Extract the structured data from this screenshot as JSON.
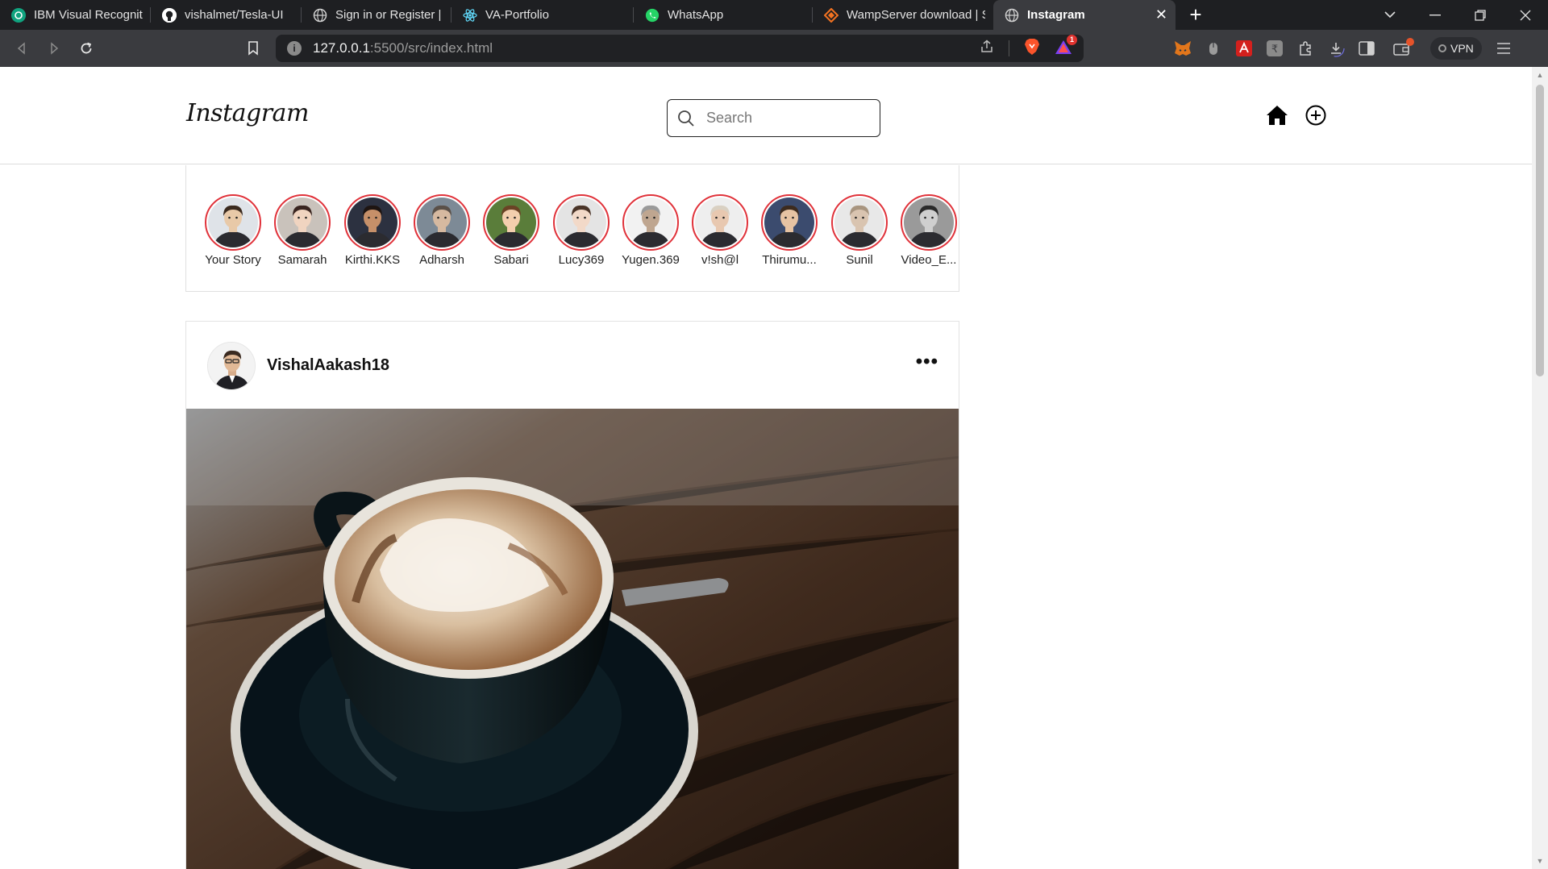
{
  "browser": {
    "tabs": [
      {
        "label": "IBM Visual Recognition with",
        "icon": "openai-icon",
        "color": "#10a37f"
      },
      {
        "label": "vishalmet/Tesla-UI",
        "icon": "github-icon",
        "color": "#ffffff"
      },
      {
        "label": "Sign in or Register | SkillUp",
        "icon": "globe-icon",
        "color": "#cfcfcf"
      },
      {
        "label": "VA-Portfolio",
        "icon": "react-icon",
        "color": "#61dafb"
      },
      {
        "label": "WhatsApp",
        "icon": "whatsapp-icon",
        "color": "#25d366"
      },
      {
        "label": "WampServer download | Sc",
        "icon": "sourceforge-icon",
        "color": "#f37321"
      },
      {
        "label": "Instagram",
        "icon": "globe-icon",
        "color": "#cfcfcf",
        "active": true
      }
    ],
    "new_tab": "+",
    "address": {
      "host": "127.0.0.1",
      "path": ":5500/src/index.html"
    },
    "brave_badge": "1",
    "vpn_label": "VPN"
  },
  "instagram": {
    "logo": "Instagram",
    "search": {
      "placeholder": "Search",
      "value": ""
    },
    "stories": [
      {
        "name": "Your Story",
        "skin": "#e8c9a8",
        "hair": "#3b2a1e",
        "bg": "#dfe3e8"
      },
      {
        "name": "Samarah",
        "skin": "#f0d4c0",
        "hair": "#3a2520",
        "bg": "#c9c2bb"
      },
      {
        "name": "Kirthi.KKS",
        "skin": "#c69069",
        "hair": "#1e1512",
        "bg": "#2c3140"
      },
      {
        "name": "Adharsh",
        "skin": "#d6b9a0",
        "hair": "#5a5048",
        "bg": "#7d8a96"
      },
      {
        "name": "Sabari",
        "skin": "#f3cfae",
        "hair": "#6a4325",
        "bg": "#5a7d3a"
      },
      {
        "name": "Lucy369",
        "skin": "#f2d9c8",
        "hair": "#4a3428",
        "bg": "#e4e4e4"
      },
      {
        "name": "Yugen.369",
        "skin": "#bfa690",
        "hair": "#9a9a9a",
        "bg": "#f2f2f2"
      },
      {
        "name": "v!sh@l",
        "skin": "#e8c8b0",
        "hair": "#d9d0c2",
        "bg": "#eeeeee"
      },
      {
        "name": "Thirumu...",
        "skin": "#e6c3a3",
        "hair": "#3c2b1f",
        "bg": "#3b4b6e"
      },
      {
        "name": "Sunil",
        "skin": "#d9c4b0",
        "hair": "#a89580",
        "bg": "#e8e8e8"
      },
      {
        "name": "Video_E...",
        "skin": "#cfcfcf",
        "hair": "#2a2a2a",
        "bg": "#9a9a9a"
      }
    ],
    "post": {
      "username": "VishalAakash18",
      "more": "•••"
    }
  }
}
